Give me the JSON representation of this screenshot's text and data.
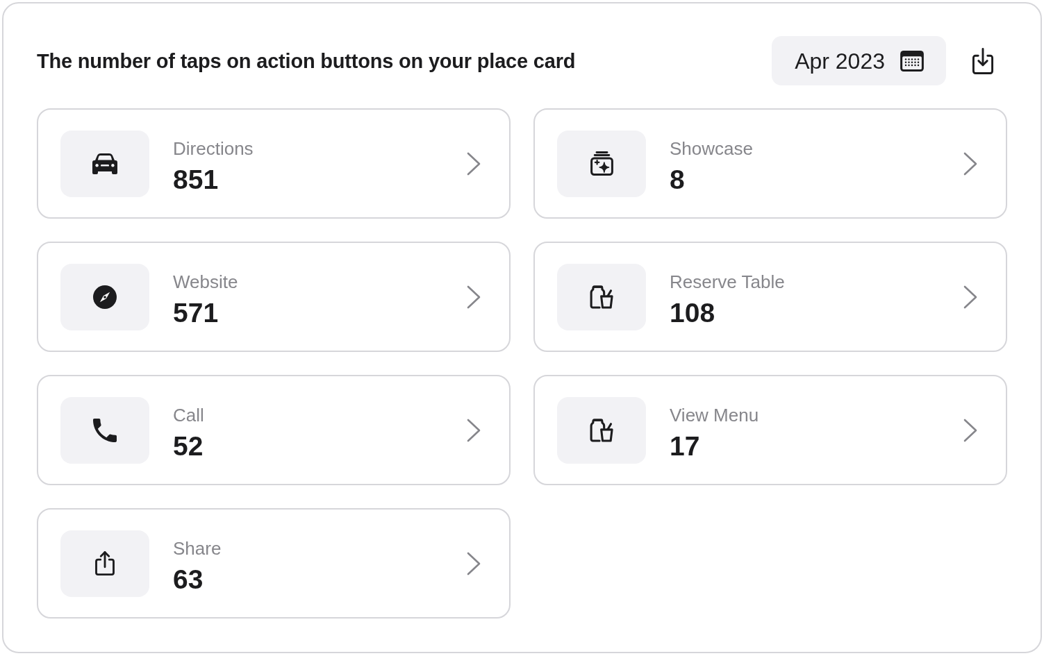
{
  "header": {
    "title": "The number of taps on action buttons on your place card",
    "date_picker": {
      "value": "Apr 2023"
    }
  },
  "actions": [
    {
      "kind": "car",
      "label": "Directions",
      "count": "851"
    },
    {
      "kind": "sparkles",
      "label": "Showcase",
      "count": "8"
    },
    {
      "kind": "compass",
      "label": "Website",
      "count": "571"
    },
    {
      "kind": "jar-cup",
      "label": "Reserve Table",
      "count": "108"
    },
    {
      "kind": "phone",
      "label": "Call",
      "count": "52"
    },
    {
      "kind": "jar-cup",
      "label": "View Menu",
      "count": "17"
    },
    {
      "kind": "share",
      "label": "Share",
      "count": "63"
    }
  ]
}
